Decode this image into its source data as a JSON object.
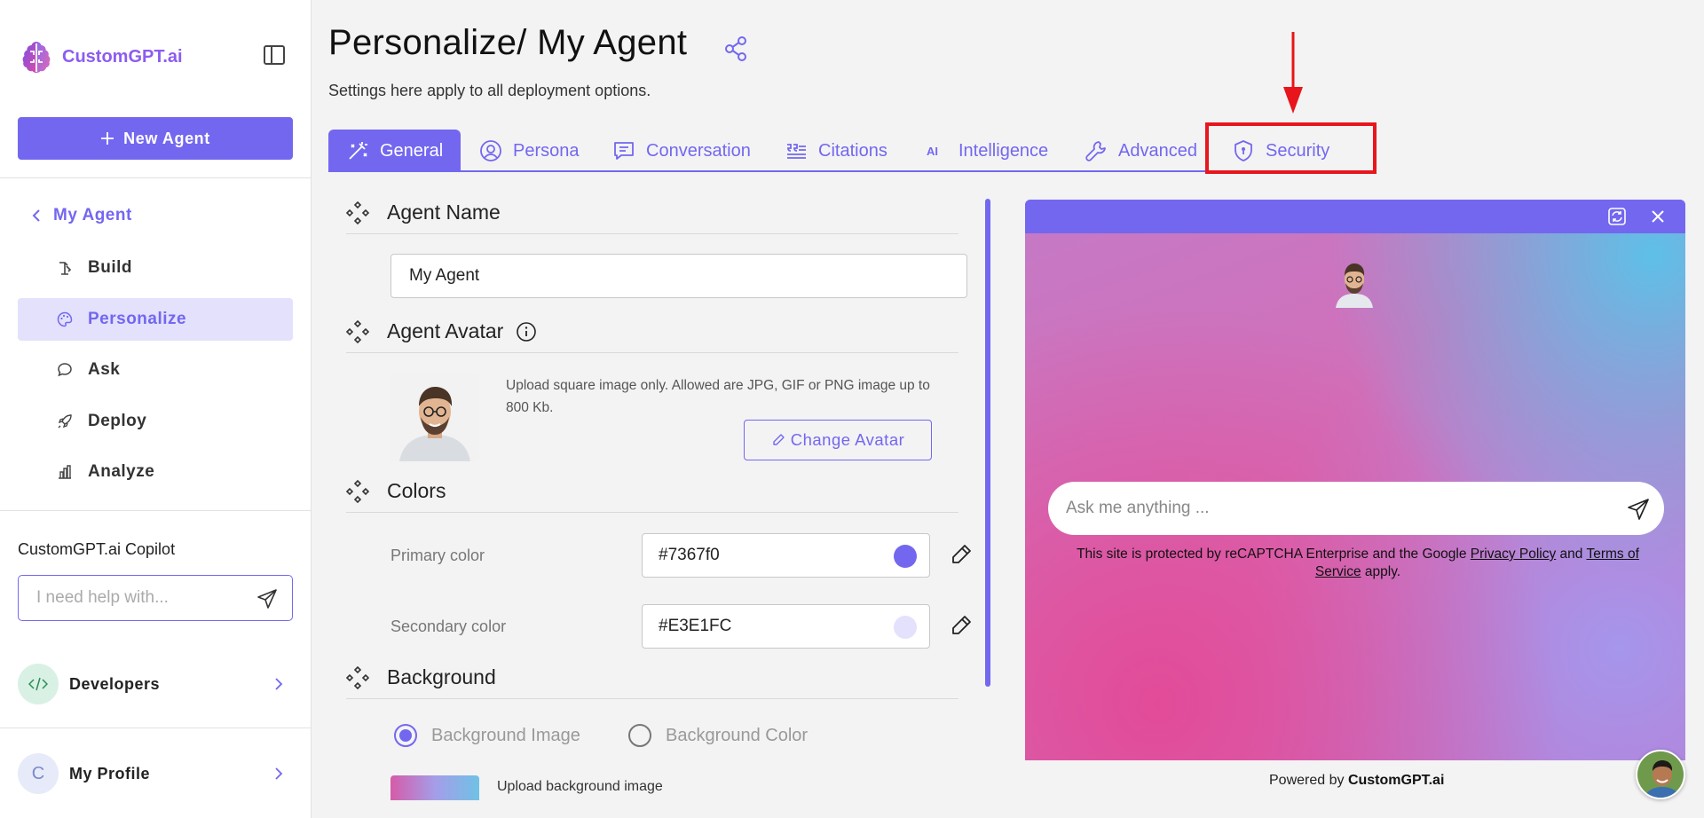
{
  "sidebar": {
    "logo_text": "CustomGPT.ai",
    "new_agent_label": "New Agent",
    "back_label": "My Agent",
    "items": [
      {
        "label": "Build",
        "icon": "build-icon"
      },
      {
        "label": "Personalize",
        "icon": "palette-icon",
        "active": true
      },
      {
        "label": "Ask",
        "icon": "chat-icon"
      },
      {
        "label": "Deploy",
        "icon": "rocket-icon"
      },
      {
        "label": "Analyze",
        "icon": "chart-icon"
      }
    ],
    "copilot_title": "CustomGPT.ai Copilot",
    "copilot_placeholder": "I need help with...",
    "developers_label": "Developers",
    "profile_initial": "C",
    "profile_label": "My Profile"
  },
  "header": {
    "title": "Personalize/ My Agent",
    "subtitle": "Settings here apply to all deployment options."
  },
  "tabs": [
    {
      "label": "General",
      "icon": "wand-icon",
      "active": true
    },
    {
      "label": "Persona",
      "icon": "persona-icon"
    },
    {
      "label": "Conversation",
      "icon": "conversation-icon"
    },
    {
      "label": "Citations",
      "icon": "citations-icon"
    },
    {
      "label": "Intelligence",
      "icon": "ai-icon"
    },
    {
      "label": "Advanced",
      "icon": "wrench-icon"
    },
    {
      "label": "Security",
      "icon": "shield-icon"
    }
  ],
  "form": {
    "agent_name_heading": "Agent Name",
    "agent_name_value": "My Agent",
    "agent_avatar_heading": "Agent Avatar",
    "upload_note": "Upload square image only. Allowed are JPG, GIF or PNG image up to 800 Kb.",
    "change_avatar_label": "Change Avatar",
    "colors_heading": "Colors",
    "primary_label": "Primary color",
    "primary_value": "#7367f0",
    "secondary_label": "Secondary color",
    "secondary_value": "#E3E1FC",
    "background_heading": "Background",
    "bg_image_label": "Background Image",
    "bg_color_label": "Background Color",
    "bg_upload_label": "Upload background image"
  },
  "preview": {
    "ask_placeholder": "Ask me anything ...",
    "captcha_prefix": "This site is protected by reCAPTCHA Enterprise and the Google ",
    "privacy_link": "Privacy Policy",
    "captcha_and": " and ",
    "terms_link": "Terms of Service",
    "captcha_suffix": " apply.",
    "powered_prefix": "Powered by ",
    "powered_brand": "CustomGPT.ai"
  },
  "colors": {
    "accent": "#7367f0",
    "accent_light": "#e3e1fc",
    "highlight": "#e8151c"
  }
}
